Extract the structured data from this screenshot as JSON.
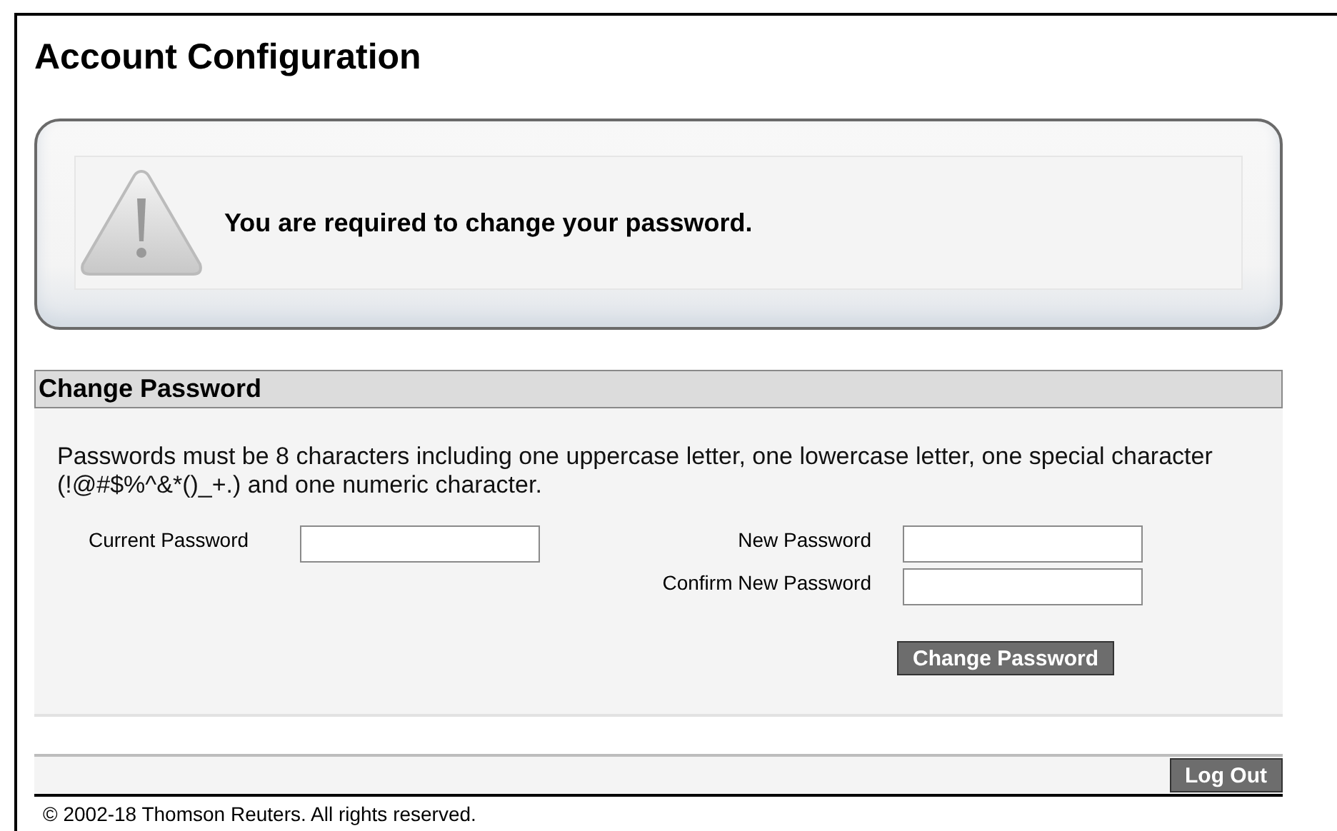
{
  "page": {
    "title": "Account Configuration"
  },
  "alert": {
    "message": "You are required to change your password."
  },
  "change_password": {
    "header": "Change Password",
    "description": "Passwords must be 8 characters including one uppercase letter, one lowercase letter, one special character (!@#$%^&*()_+.) and one numeric character.",
    "left_fields": [
      {
        "label": "Current Password"
      }
    ],
    "right_fields": [
      {
        "label": "New Password"
      },
      {
        "label": "Confirm New Password"
      }
    ],
    "submit": "Change Password"
  },
  "footer": {
    "logout": "Log Out",
    "copyright": "© 2002-18 Thomson Reuters. All rights reserved."
  }
}
